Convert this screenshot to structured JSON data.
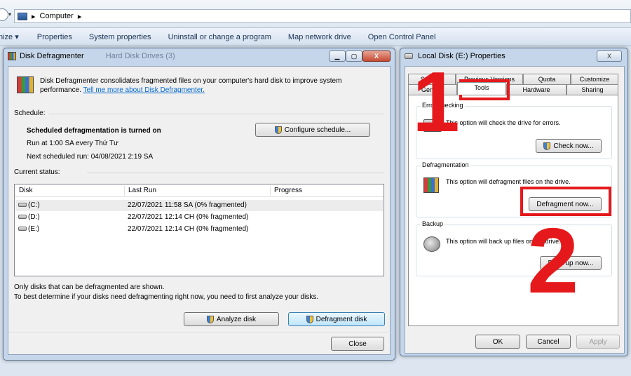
{
  "explorer": {
    "address": "Computer",
    "commands": [
      "nize ▾",
      "Properties",
      "System properties",
      "Uninstall or change a program",
      "Map network drive",
      "Open Control Panel"
    ]
  },
  "defrag": {
    "title": "Disk Defragmenter",
    "behind_title": "Hard Disk Drives (3)",
    "desc_text": "Disk Defragmenter consolidates fragmented files on your computer's hard disk to improve system performance.",
    "desc_link": "Tell me more about Disk Defragmenter.",
    "schedule_label": "Schedule:",
    "schedule_status": "Scheduled defragmentation is turned on",
    "run_at": "Run at 1:00 SA every Thứ Tư",
    "next_run": "Next scheduled run: 04/08/2021 2:19 SA",
    "configure_btn": "Configure schedule...",
    "current_status_label": "Current status:",
    "columns": [
      "Disk",
      "Last Run",
      "Progress"
    ],
    "rows": [
      {
        "disk": "(C:)",
        "last_run": "22/07/2021 11:58 SA (0% fragmented)",
        "progress": ""
      },
      {
        "disk": "(D:)",
        "last_run": "22/07/2021 12:14 CH (0% fragmented)",
        "progress": ""
      },
      {
        "disk": "(E:)",
        "last_run": "22/07/2021 12:14 CH (0% fragmented)",
        "progress": ""
      }
    ],
    "note1": "Only disks that can be defragmented are shown.",
    "note2": "To best determine if your disks need defragmenting right now, you need to first analyze your disks.",
    "analyze_btn": "Analyze disk",
    "defrag_btn": "Defragment disk",
    "close_btn": "Close",
    "caption_close": "X"
  },
  "props": {
    "title": "Local Disk (E:) Properties",
    "caption_close": "X",
    "tabs_row1": [
      "Security",
      "Previous Versions",
      "Quota",
      "Customize"
    ],
    "tabs_row2": [
      "General",
      "Tools",
      "Hardware",
      "Sharing"
    ],
    "error_title": "Error-checking",
    "error_text": "This option will check the drive for errors.",
    "check_btn": "Check now...",
    "defrag_title": "Defragmentation",
    "defrag_text": "This option will defragment files on the drive.",
    "defrag_btn": "Defragment now...",
    "backup_title": "Backup",
    "backup_text": "This option will back up files on the drive.",
    "backup_btn": "Back up now...",
    "ok_btn": "OK",
    "cancel_btn": "Cancel",
    "apply_btn": "Apply"
  },
  "annotations": {
    "one": "1",
    "two": "2",
    "color": "#e5191c"
  }
}
